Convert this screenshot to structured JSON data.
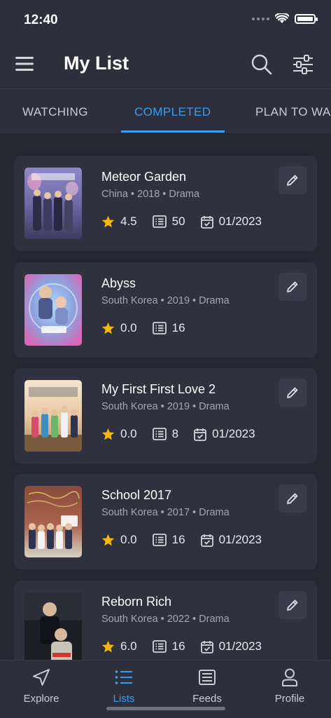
{
  "status_bar": {
    "time": "12:40"
  },
  "header": {
    "title": "My List"
  },
  "tabs": [
    {
      "label": "WATCHING",
      "active": false
    },
    {
      "label": "COMPLETED",
      "active": true
    },
    {
      "label": "PLAN TO WA",
      "active": false
    }
  ],
  "list": [
    {
      "title": "Meteor Garden",
      "meta": "China • 2018 • Drama",
      "rating": "4.5",
      "episodes": "50",
      "date": "01/2023",
      "poster": "meteor-garden-poster"
    },
    {
      "title": "Abyss",
      "meta": "South Korea • 2019 • Drama",
      "rating": "0.0",
      "episodes": "16",
      "date": "",
      "poster": "abyss-poster"
    },
    {
      "title": "My First First Love 2",
      "meta": "South Korea • 2019 • Drama",
      "rating": "0.0",
      "episodes": "8",
      "date": "01/2023",
      "poster": "my-first-first-love-2-poster"
    },
    {
      "title": "School 2017",
      "meta": "South Korea • 2017 • Drama",
      "rating": "0.0",
      "episodes": "16",
      "date": "01/2023",
      "poster": "school-2017-poster"
    },
    {
      "title": "Reborn Rich",
      "meta": "South Korea • 2022 • Drama",
      "rating": "6.0",
      "episodes": "16",
      "date": "01/2023",
      "poster": "reborn-rich-poster"
    }
  ],
  "bottom_nav": [
    {
      "label": "Explore",
      "icon": "navigation-arrow-icon",
      "active": false
    },
    {
      "label": "Lists",
      "icon": "list-icon",
      "active": true
    },
    {
      "label": "Feeds",
      "icon": "newspaper-icon",
      "active": false
    },
    {
      "label": "Profile",
      "icon": "person-icon",
      "active": false
    }
  ],
  "colors": {
    "accent": "#3b9eed",
    "star": "#f5b80c",
    "background": "#262733",
    "card": "#30313f"
  }
}
